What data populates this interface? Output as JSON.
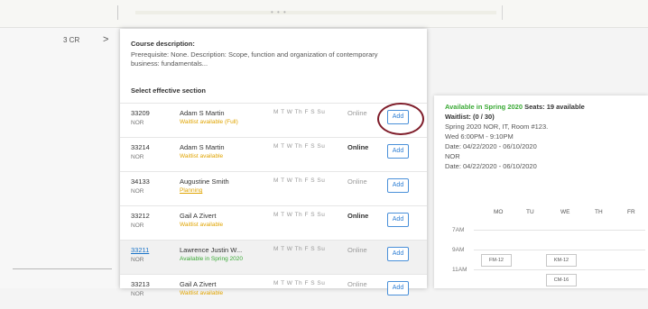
{
  "sidebar": {
    "credits": "3 CR",
    "chevron": ">"
  },
  "description": {
    "title": "Course description:",
    "text": "Prerequisite: None. Description: Scope, function and organization of contemporary business: fundamentals...",
    "select_label": "Select effective section"
  },
  "sections": [
    {
      "code": "33209",
      "campus": "NOR",
      "instructor": "Adam S Martin",
      "status": "Waitlist available (Full)",
      "status_color": "#e0a400",
      "days": "M T W Th F S Su",
      "mode": "Online",
      "add": "Add"
    },
    {
      "code": "33214",
      "campus": "NOR",
      "instructor": "Adam S Martin",
      "status": "Waitlist available",
      "status_color": "#e0a400",
      "days": "M T W Th F S Su",
      "mode": "Online",
      "add": "Add"
    },
    {
      "code": "34133",
      "campus": "NOR",
      "instructor": "Augustine Smith",
      "status": "Planning",
      "status_color": "#e0a400",
      "days": "M T W Th F S Su",
      "mode": "Online",
      "add": "Add"
    },
    {
      "code": "33212",
      "campus": "NOR",
      "instructor": "Gail A Zivert",
      "status": "Waitlist available",
      "status_color": "#e0a400",
      "days": "M T W Th F S Su",
      "mode": "Online",
      "add": "Add"
    },
    {
      "code": "33211",
      "campus": "NOR",
      "instructor": "Lawrence Justin W...",
      "status": "Available in Spring 2020",
      "status_color": "#3aa935",
      "days": "M T W Th F S Su",
      "mode": "Online",
      "add": "Add"
    },
    {
      "code": "33213",
      "campus": "NOR",
      "instructor": "Gail A Zivert",
      "status": "Waitlist available",
      "status_color": "#e0a400",
      "days": "M T W Th F S Su",
      "mode": "Online",
      "add": "Add"
    }
  ],
  "detail": {
    "available": "Available in Spring 2020",
    "seats": "Seats: 19 available",
    "waitlist": "Waitlist: (0 / 30)",
    "location": "Spring 2020 NOR, IT, Room #123.",
    "time": "Wed 6:00PM - 9:10PM",
    "date1": "Date: 04/22/2020 - 06/10/2020",
    "campus": "NOR",
    "date2": "Date: 04/22/2020 - 06/10/2020",
    "days": [
      "MO",
      "TU",
      "WE",
      "TH",
      "FR"
    ],
    "times": [
      "7AM",
      "9AM",
      "11AM"
    ],
    "blocks": [
      "FM-12",
      "KM-12",
      "CM-16"
    ]
  }
}
